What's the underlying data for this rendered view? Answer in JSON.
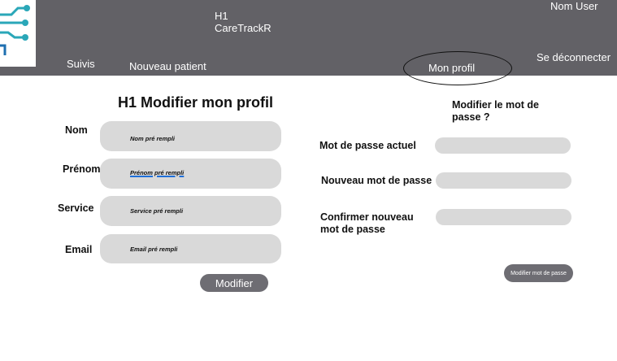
{
  "header": {
    "title_line1": "H1",
    "title_line2": "CareTrackR",
    "user_name": "Nom User",
    "nav": {
      "suivis": "Suivis",
      "nouveau_patient": "Nouveau patient",
      "mon_profil": "Mon profil",
      "logout": "Se déconnecter"
    }
  },
  "profile_form": {
    "title": "H1 Modifier mon profil",
    "fields": [
      {
        "label": "Nom",
        "value": "Nom pré rempli"
      },
      {
        "label": "Prénom",
        "value": "Prénom pré rempli"
      },
      {
        "label": "Service",
        "value": "Service pré rempli"
      },
      {
        "label": "Email",
        "value": "Email pré rempli"
      }
    ],
    "submit_label": "Modifier"
  },
  "password_form": {
    "title": "Modifier le mot de passe ?",
    "fields": [
      {
        "label": "Mot de passe actuel"
      },
      {
        "label": "Nouveau mot de passe"
      },
      {
        "label": "Confirmer nouveau mot de passe"
      }
    ],
    "submit_label": "Modifier mot de passe"
  },
  "colors": {
    "header_bg": "#626166",
    "field_bg": "#d9d9d9",
    "button_bg": "#6e6d73",
    "logo_teal": "#2aa7b8"
  }
}
